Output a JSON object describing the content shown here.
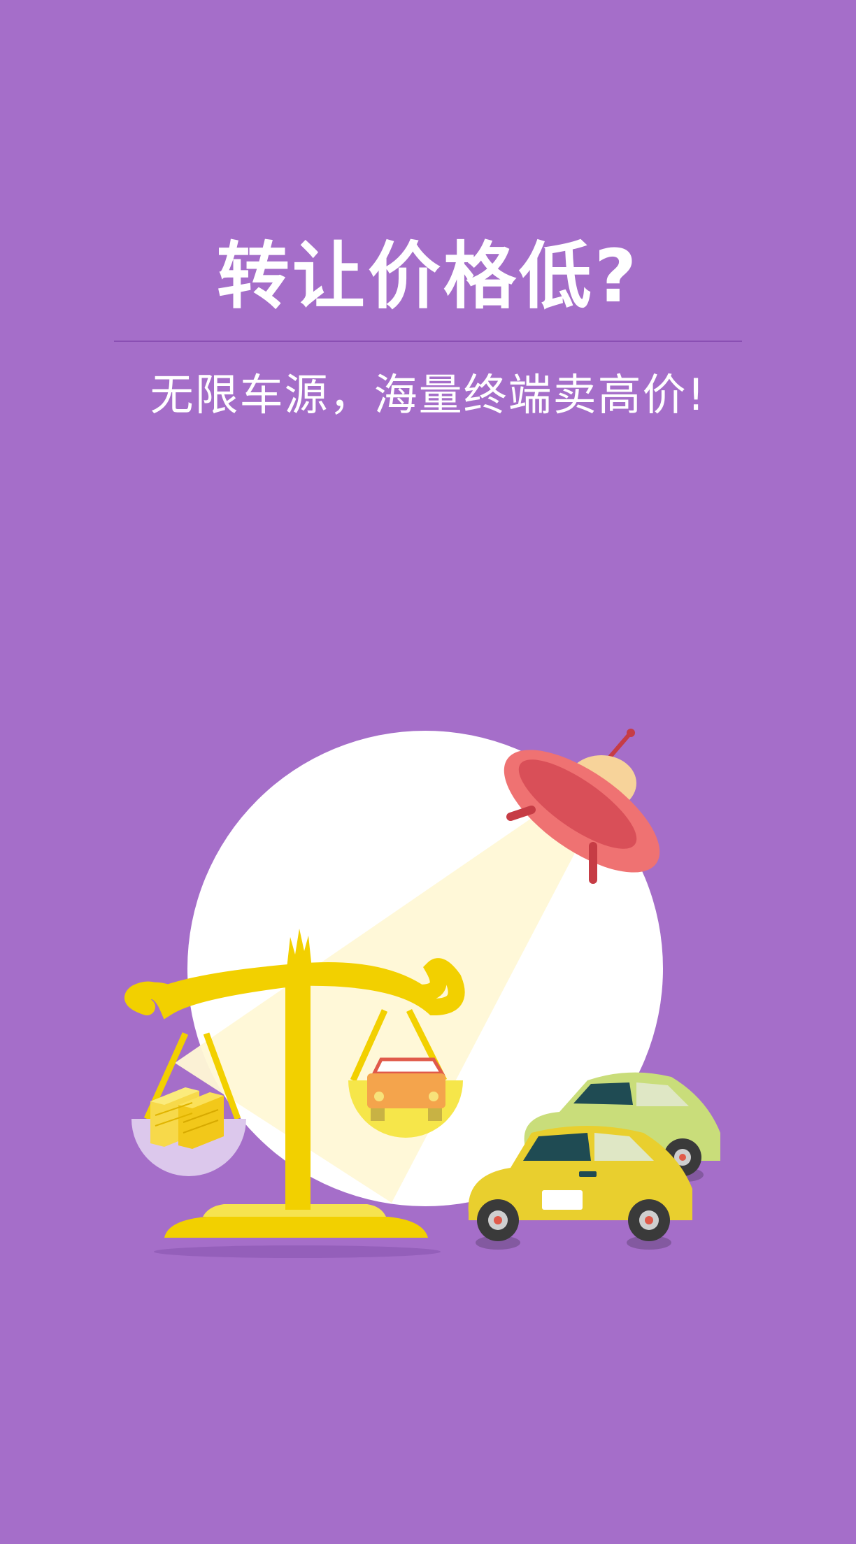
{
  "splash": {
    "headline": "转让价格低?",
    "subline": "无限车源，海量终端卖高价!"
  },
  "colors": {
    "background": "#a56ec9",
    "divider": "#8a4fb3",
    "text": "#ffffff",
    "scale_gold": "#f2d000",
    "ufo_red": "#e8666a",
    "car_yellow": "#e9cf2e",
    "car_green": "#c9dd7a"
  },
  "illustration": {
    "icons": [
      "scale-icon",
      "ufo-icon",
      "money-stack-icon",
      "car-icon"
    ]
  }
}
